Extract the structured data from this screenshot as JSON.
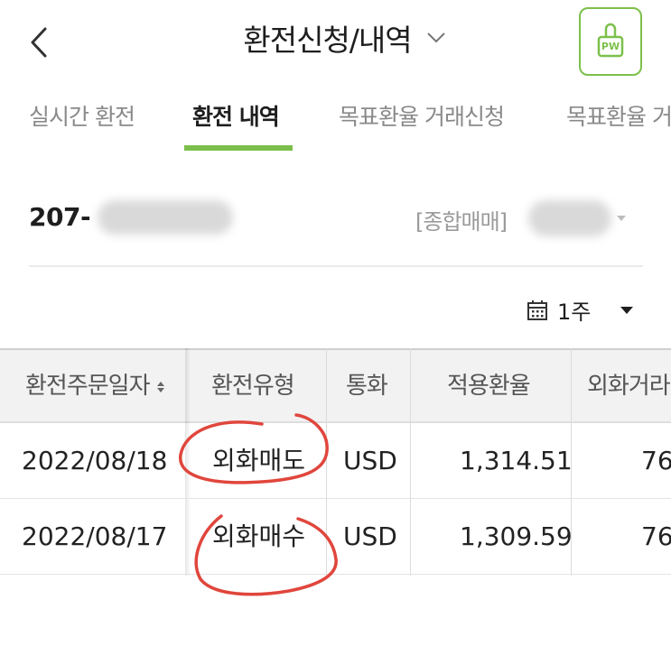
{
  "header": {
    "title": "환전신청/내역",
    "back_icon": "chevron-left-icon",
    "dropdown_icon": "chevron-down-icon",
    "pw_label": "PW",
    "pw_icon": "lock-pw-icon"
  },
  "tabs": [
    {
      "label": "실시간 환전",
      "active": false
    },
    {
      "label": "환전 내역",
      "active": true
    },
    {
      "label": "목표환율 거래신청",
      "active": false
    },
    {
      "label": "목표환율 거",
      "active": false
    }
  ],
  "account": {
    "number_prefix": "207-",
    "type_label": "[종합매매]"
  },
  "period": {
    "icon": "calendar-icon",
    "value": "1주",
    "dropdown_icon": "caret-down-icon"
  },
  "table": {
    "columns": [
      "환전주문일자",
      "환전유형",
      "통화",
      "적용환율",
      "외화거라"
    ],
    "sort_icon": "sort-arrows-icon",
    "rows": [
      {
        "date": "2022/08/18",
        "type": "외화매도",
        "currency": "USD",
        "rate": "1,314.51",
        "amount": "76"
      },
      {
        "date": "2022/08/17",
        "type": "외화매수",
        "currency": "USD",
        "rate": "1,309.59",
        "amount": "76"
      }
    ]
  },
  "colors": {
    "accent": "#7cc04b",
    "annotation": "#e0463c"
  }
}
